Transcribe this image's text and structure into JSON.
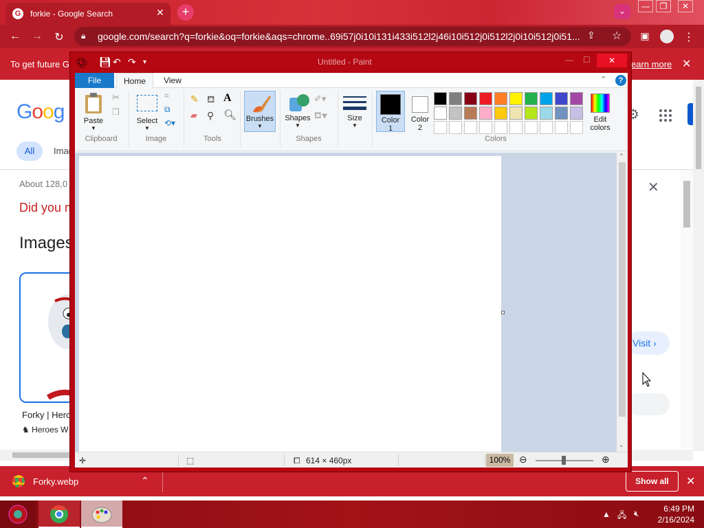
{
  "browser": {
    "tab_title": "forkie - Google Search",
    "tab_favicon": "G",
    "url": "google.com/search?q=forkie&oq=forkie&aqs=chrome..69i57j0i10i131i433i512l2j46i10i512j0i512l2j0i10i512j0i51...",
    "info_text": "To get future G",
    "info_link": "earn more",
    "accent": "#c8202c"
  },
  "google": {
    "logo": "Goog",
    "tab_all": "All",
    "tab_images_partial": "Imag",
    "about": "About 128,0",
    "did_you_mean": "Did you m",
    "images_heading": "Images",
    "result_title": "Forky | Hero",
    "result_source": "Heroes W",
    "visit_label": "Visit"
  },
  "downloads": {
    "file": "Forky.webp",
    "show_all": "Show all"
  },
  "taskbar": {
    "time": "6:49 PM",
    "date": "2/16/2024"
  },
  "paint": {
    "title": "Untitled - Paint",
    "tabs": {
      "file": "File",
      "home": "Home",
      "view": "View"
    },
    "help": "?",
    "groups": {
      "clipboard": "Clipboard",
      "image": "Image",
      "tools": "Tools",
      "shapes": "Shapes",
      "colors": "Colors"
    },
    "buttons": {
      "paste": "Paste",
      "select": "Select",
      "brushes": "Brushes",
      "shapes": "Shapes",
      "size": "Size",
      "color1_a": "Color",
      "color1_b": "1",
      "color2_a": "Color",
      "color2_b": "2",
      "edit_a": "Edit",
      "edit_b": "colors"
    },
    "color1": "#000000",
    "color2": "#ffffff",
    "palette_row1": [
      "#000000",
      "#7f7f7f",
      "#880015",
      "#ed1c24",
      "#ff7f27",
      "#fff200",
      "#22b14c",
      "#00a2e8",
      "#3f48cc",
      "#a349a4"
    ],
    "palette_row2": [
      "#ffffff",
      "#c3c3c3",
      "#b97a57",
      "#ffaec9",
      "#ffc90e",
      "#efe4b0",
      "#b5e61d",
      "#99d9ea",
      "#7092be",
      "#c8bfe7"
    ],
    "palette_row3": [
      "#ffffff",
      "#ffffff",
      "#ffffff",
      "#ffffff",
      "#ffffff",
      "#ffffff",
      "#ffffff",
      "#ffffff",
      "#ffffff",
      "#ffffff"
    ],
    "status": {
      "canvas_size": "614 × 460px",
      "zoom": "100%"
    }
  }
}
